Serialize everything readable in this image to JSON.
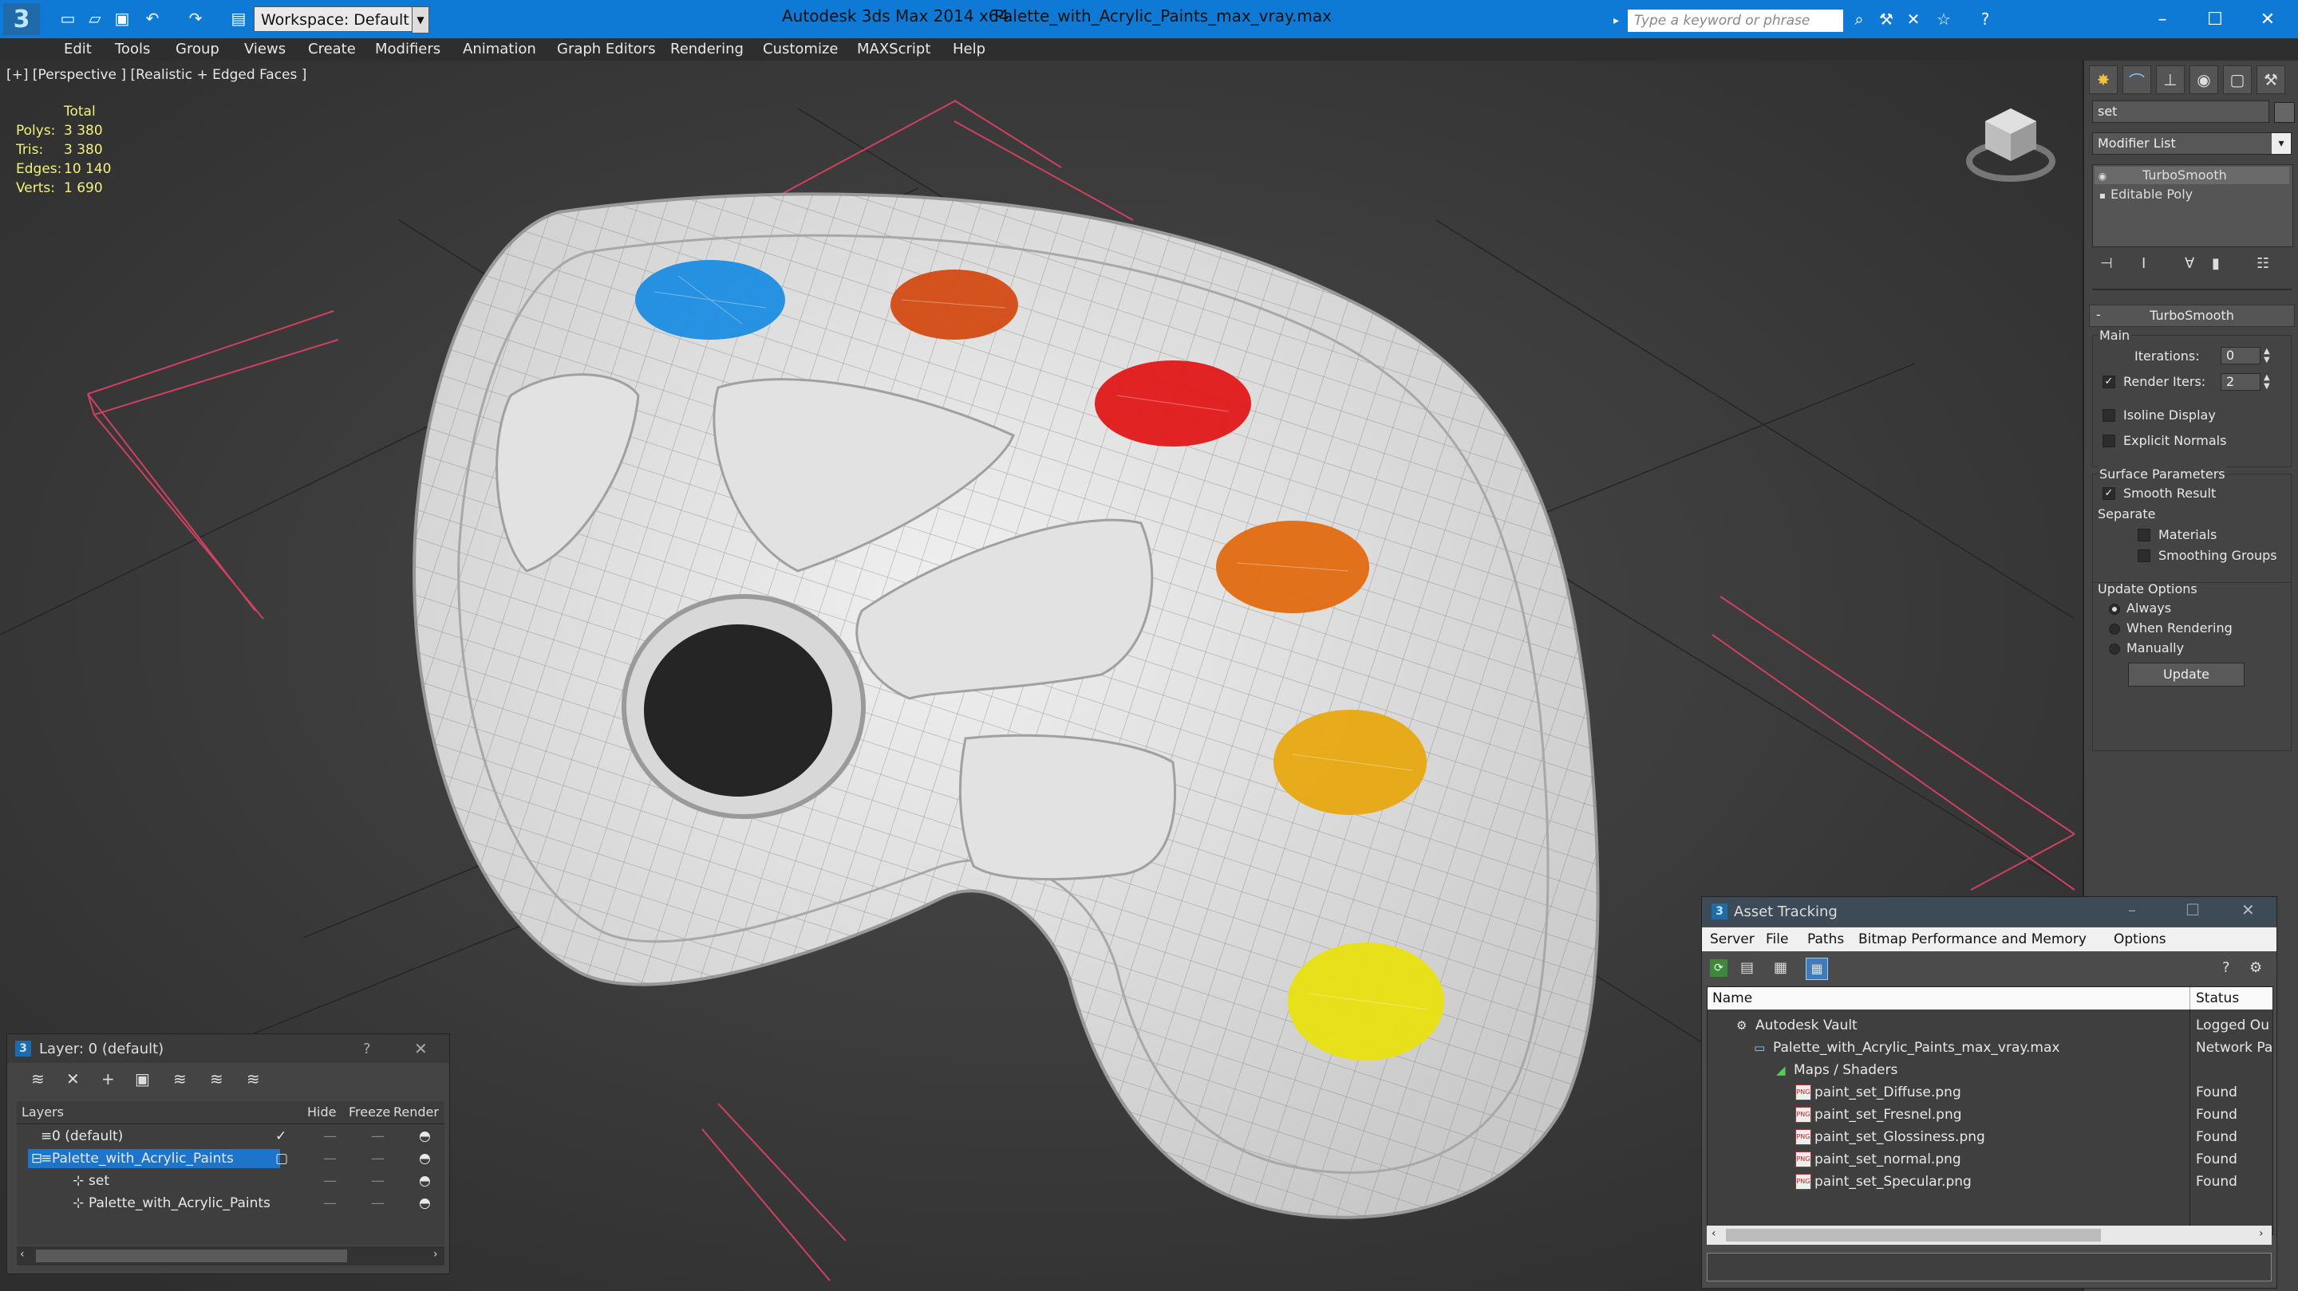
{
  "app": {
    "logo_letter": "3",
    "title": "Autodesk 3ds Max  2014 x64",
    "file": "Palette_with_Acrylic_Paints_max_vray.max",
    "workspace": "Workspace: Default",
    "search_placeholder": "Type a keyword or phrase"
  },
  "menu": [
    "Edit",
    "Tools",
    "Group",
    "Views",
    "Create",
    "Modifiers",
    "Animation",
    "Graph Editors",
    "Rendering",
    "Customize",
    "MAXScript",
    "Help"
  ],
  "viewport": {
    "label": "[+] [Perspective ] [Realistic + Edged Faces ]",
    "stats_header": "Total",
    "stats": [
      {
        "k": "Polys:",
        "v": "3 380"
      },
      {
        "k": "Tris:",
        "v": "3 380"
      },
      {
        "k": "Edges:",
        "v": "10 140"
      },
      {
        "k": "Verts:",
        "v": "1 690"
      }
    ],
    "paints": [
      "#1c8de0",
      "#d24a12",
      "#e01818",
      "#e06a10",
      "#e8a810",
      "#e8e010"
    ]
  },
  "cmdpanel": {
    "object_name": "set",
    "modifier_list": "Modifier List",
    "stack": [
      "TurboSmooth",
      "Editable Poly"
    ],
    "rollout_title": "TurboSmooth",
    "main_label": "Main",
    "iterations_label": "Iterations:",
    "iterations_value": "0",
    "render_iters_label": "Render Iters:",
    "render_iters_value": "2",
    "isoline": "Isoline Display",
    "explicit_normals": "Explicit Normals",
    "surface_params": "Surface Parameters",
    "smooth_result": "Smooth Result",
    "separate": "Separate",
    "materials": "Materials",
    "smoothing_groups": "Smoothing Groups",
    "update_options": "Update Options",
    "always": "Always",
    "when_rendering": "When Rendering",
    "manually": "Manually",
    "update_btn": "Update"
  },
  "layers": {
    "title": "Layer: 0 (default)",
    "help": "?",
    "col_layers": "Layers",
    "col_hide": "Hide",
    "col_freeze": "Freeze",
    "col_render": "Render",
    "rows": [
      {
        "name": "0 (default)",
        "indent": 1
      },
      {
        "name": "Palette_with_Acrylic_Paints",
        "indent": 1
      },
      {
        "name": "set",
        "indent": 2
      },
      {
        "name": "Palette_with_Acrylic_Paints",
        "indent": 2
      }
    ]
  },
  "assets": {
    "title": "Asset Tracking",
    "menu": [
      "Server",
      "File",
      "Paths",
      "Bitmap Performance and Memory",
      "Options"
    ],
    "col_name": "Name",
    "col_status": "Status",
    "rows": [
      {
        "name": "Autodesk Vault",
        "status": "Logged Ou",
        "indent": 1,
        "kind": "vault"
      },
      {
        "name": "Palette_with_Acrylic_Paints_max_vray.max",
        "status": "Network Pa",
        "indent": 2,
        "kind": "max"
      },
      {
        "name": "Maps / Shaders",
        "status": "",
        "indent": 3,
        "kind": "maps"
      },
      {
        "name": "paint_set_Diffuse.png",
        "status": "Found",
        "indent": 4,
        "kind": "png"
      },
      {
        "name": "paint_set_Fresnel.png",
        "status": "Found",
        "indent": 4,
        "kind": "png"
      },
      {
        "name": "paint_set_Glossiness.png",
        "status": "Found",
        "indent": 4,
        "kind": "png"
      },
      {
        "name": "paint_set_normal.png",
        "status": "Found",
        "indent": 4,
        "kind": "png"
      },
      {
        "name": "paint_set_Specular.png",
        "status": "Found",
        "indent": 4,
        "kind": "png"
      }
    ]
  }
}
